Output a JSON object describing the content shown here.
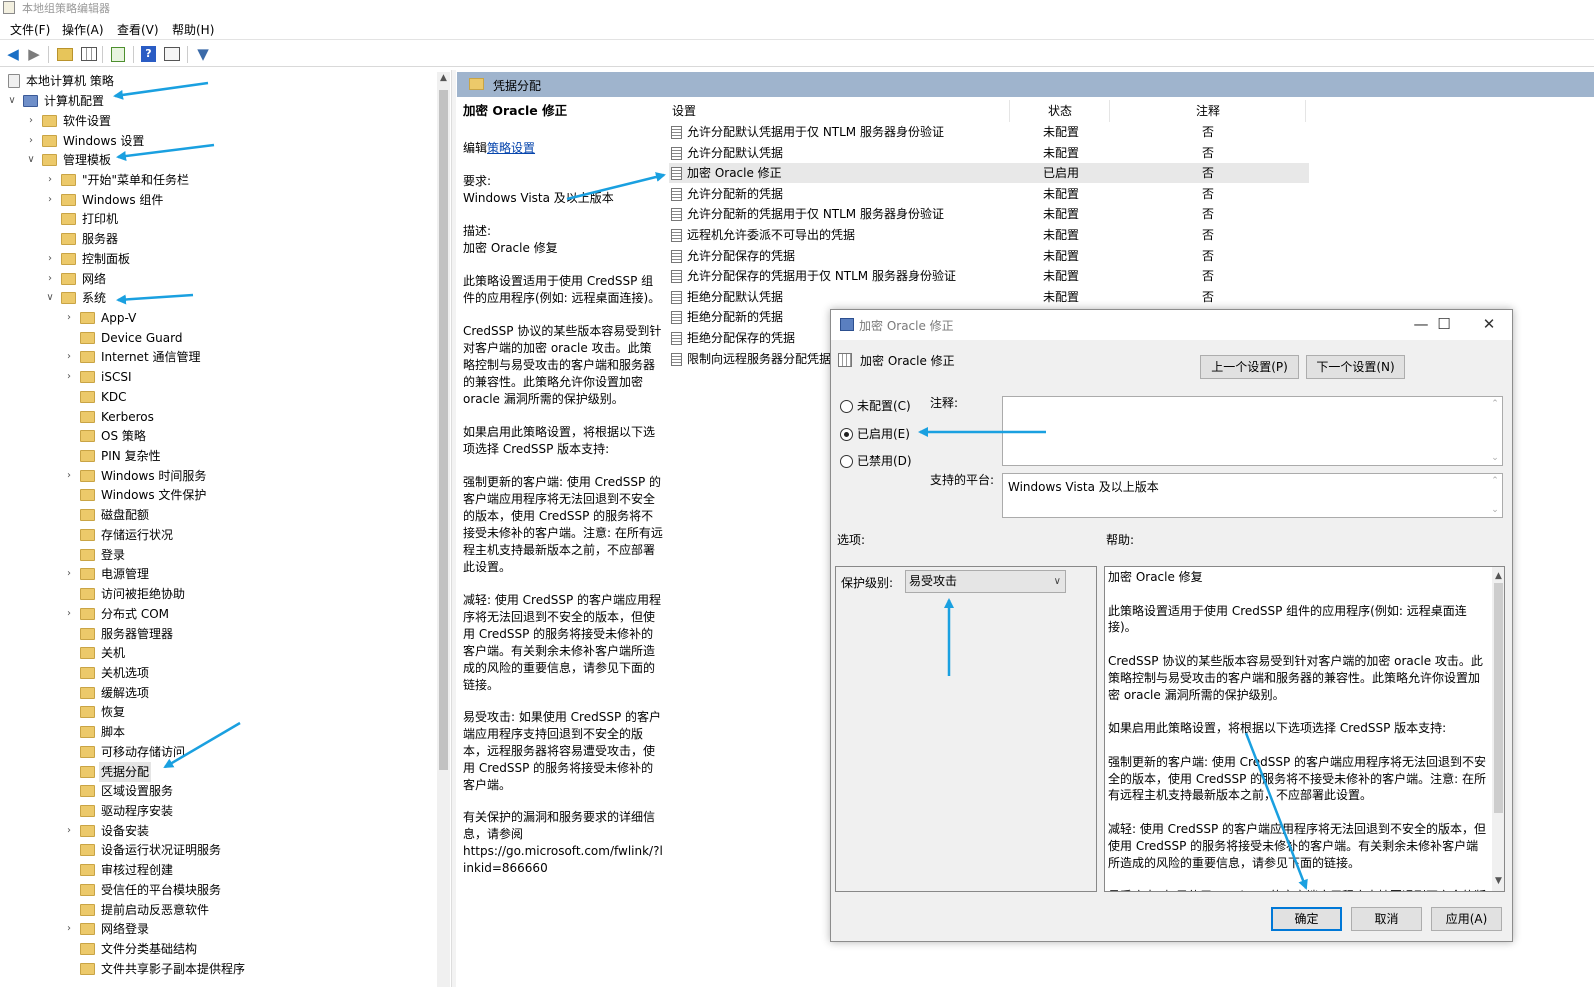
{
  "window": {
    "title": "本地组策略编辑器"
  },
  "menu": [
    "文件(F)",
    "操作(A)",
    "查看(V)",
    "帮助(H)"
  ],
  "toolbar": {
    "icons": [
      "back-arrow-icon",
      "forward-arrow-icon",
      "up-folder-icon",
      "show-hide-tree-icon",
      "export-list-icon",
      "help-icon",
      "properties-icon",
      "filter-icon"
    ]
  },
  "tree": {
    "root": "本地计算机 策略",
    "computer_config": "计算机配置",
    "software": "软件设置",
    "windows_settings": "Windows 设置",
    "admin_templates": "管理模板",
    "children": [
      {
        "label": "\"开始\"菜单和任务栏",
        "exp": true
      },
      {
        "label": "Windows 组件",
        "exp": true
      },
      {
        "label": "打印机",
        "exp": false
      },
      {
        "label": "服务器",
        "exp": false
      },
      {
        "label": "控制面板",
        "exp": true
      },
      {
        "label": "网络",
        "exp": true
      }
    ],
    "system": "系统",
    "system_children": [
      {
        "label": "App-V",
        "exp": true
      },
      {
        "label": "Device Guard",
        "exp": false
      },
      {
        "label": "Internet 通信管理",
        "exp": true
      },
      {
        "label": "iSCSI",
        "exp": true
      },
      {
        "label": "KDC",
        "exp": false
      },
      {
        "label": "Kerberos",
        "exp": false
      },
      {
        "label": "OS 策略",
        "exp": false
      },
      {
        "label": "PIN 复杂性",
        "exp": false
      },
      {
        "label": "Windows 时间服务",
        "exp": true
      },
      {
        "label": "Windows 文件保护",
        "exp": false
      },
      {
        "label": "磁盘配额",
        "exp": false
      },
      {
        "label": "存储运行状况",
        "exp": false
      },
      {
        "label": "登录",
        "exp": false
      },
      {
        "label": "电源管理",
        "exp": true
      },
      {
        "label": "访问被拒绝协助",
        "exp": false
      },
      {
        "label": "分布式 COM",
        "exp": true
      },
      {
        "label": "服务器管理器",
        "exp": false
      },
      {
        "label": "关机",
        "exp": false
      },
      {
        "label": "关机选项",
        "exp": false
      },
      {
        "label": "缓解选项",
        "exp": false
      },
      {
        "label": "恢复",
        "exp": false
      },
      {
        "label": "脚本",
        "exp": false
      },
      {
        "label": "可移动存储访问",
        "exp": false
      },
      {
        "label": "凭据分配",
        "exp": false,
        "sel": true
      },
      {
        "label": "区域设置服务",
        "exp": false
      },
      {
        "label": "驱动程序安装",
        "exp": false
      },
      {
        "label": "设备安装",
        "exp": true
      },
      {
        "label": "设备运行状况证明服务",
        "exp": false
      },
      {
        "label": "审核过程创建",
        "exp": false
      },
      {
        "label": "受信任的平台模块服务",
        "exp": false
      },
      {
        "label": "提前启动反恶意软件",
        "exp": false
      },
      {
        "label": "网络登录",
        "exp": true
      },
      {
        "label": "文件分类基础结构",
        "exp": false
      },
      {
        "label": "文件共享影子副本提供程序",
        "exp": false
      }
    ]
  },
  "right": {
    "header": "凭据分配",
    "desc": {
      "title": "加密 Oracle 修正",
      "edit_prefix": "编辑",
      "edit_link": "策略设置",
      "req_label": "要求:",
      "req_value": "Windows Vista 及以上版本",
      "desc_label": "描述:",
      "desc_value": "加密 Oracle 修复",
      "p1": "此策略设置适用于使用 CredSSP 组件的应用程序(例如: 远程桌面连接)。",
      "p2": "CredSSP 协议的某些版本容易受到针对客户端的加密 oracle 攻击。此策略控制与易受攻击的客户端和服务器的兼容性。此策略允许你设置加密 oracle 漏洞所需的保护级别。",
      "p3": "如果启用此策略设置，将根据以下选项选择 CredSSP 版本支持:",
      "p4": "强制更新的客户端: 使用 CredSSP 的客户端应用程序将无法回退到不安全的版本，使用 CredSSP 的服务将不接受未修补的客户端。注意: 在所有远程主机支持最新版本之前，不应部署此设置。",
      "p5": "减轻: 使用 CredSSP 的客户端应用程序将无法回退到不安全的版本，但使用 CredSSP 的服务将接受未修补的客户端。有关剩余未修补客户端所造成的风险的重要信息，请参见下面的链接。",
      "p6": "易受攻击: 如果使用 CredSSP 的客户端应用程序支持回退到不安全的版本，远程服务器将容易遭受攻击，使用 CredSSP 的服务将接受未修补的客户端。",
      "p7": "有关保护的漏洞和服务要求的详细信息，请参阅",
      "p8": "https://go.microsoft.com/fwlink/?linkid=866660"
    },
    "columns": {
      "setting": "设置",
      "state": "状态",
      "note": "注释"
    },
    "rows": [
      {
        "name": "允许分配默认凭据用于仅 NTLM 服务器身份验证",
        "state": "未配置",
        "note": "否"
      },
      {
        "name": "允许分配默认凭据",
        "state": "未配置",
        "note": "否"
      },
      {
        "name": "加密 Oracle 修正",
        "state": "已启用",
        "note": "否",
        "sel": true
      },
      {
        "name": "允许分配新的凭据",
        "state": "未配置",
        "note": "否"
      },
      {
        "name": "允许分配新的凭据用于仅 NTLM 服务器身份验证",
        "state": "未配置",
        "note": "否"
      },
      {
        "name": "远程机允许委派不可导出的凭据",
        "state": "未配置",
        "note": "否"
      },
      {
        "name": "允许分配保存的凭据",
        "state": "未配置",
        "note": "否"
      },
      {
        "name": "允许分配保存的凭据用于仅 NTLM 服务器身份验证",
        "state": "未配置",
        "note": "否"
      },
      {
        "name": "拒绝分配默认凭据",
        "state": "未配置",
        "note": "否"
      },
      {
        "name": "拒绝分配新的凭据",
        "state": "",
        "note": ""
      },
      {
        "name": "拒绝分配保存的凭据",
        "state": "",
        "note": ""
      },
      {
        "name": "限制向远程服务器分配凭据",
        "state": "",
        "note": ""
      }
    ]
  },
  "dialog": {
    "title": "加密 Oracle 修正",
    "subtitle": "加密 Oracle 修正",
    "prev_btn": "上一个设置(P)",
    "next_btn": "下一个设置(N)",
    "radio_not_configured": "未配置(C)",
    "radio_enabled": "已启用(E)",
    "radio_disabled": "已禁用(D)",
    "comment_label": "注释:",
    "platform_label": "支持的平台:",
    "platform_value": "Windows Vista 及以上版本",
    "options_label": "选项:",
    "help_label": "帮助:",
    "protection_label": "保护级别:",
    "protection_value": "易受攻击",
    "help_text": [
      "加密 Oracle 修复",
      "此策略设置适用于使用 CredSSP 组件的应用程序(例如: 远程桌面连接)。",
      "CredSSP 协议的某些版本容易受到针对客户端的加密 oracle 攻击。此策略控制与易受攻击的客户端和服务器的兼容性。此策略允许你设置加密 oracle 漏洞所需的保护级别。",
      "如果启用此策略设置，将根据以下选项选择 CredSSP 版本支持:",
      "强制更新的客户端: 使用 CredSSP 的客户端应用程序将无法回退到不安全的版本，使用 CredSSP 的服务将不接受未修补的客户端。注意: 在所有远程主机支持最新版本之前，不应部署此设置。",
      "减轻: 使用 CredSSP 的客户端应用程序将无法回退到不安全的版本，但使用 CredSSP 的服务将接受未修补的客户端。有关剩余未修补客户端所造成的风险的重要信息，请参见下面的链接。",
      "易受攻击: 如果使用 CredSSP 的客户端应用程序支持回退到不安全的版本"
    ],
    "ok": "确定",
    "cancel": "取消",
    "apply": "应用(A)"
  },
  "colors": {
    "accent": "#0078d7",
    "annotation_arrow": "#1aa0e0",
    "header_bg": "#9fb4cd"
  }
}
